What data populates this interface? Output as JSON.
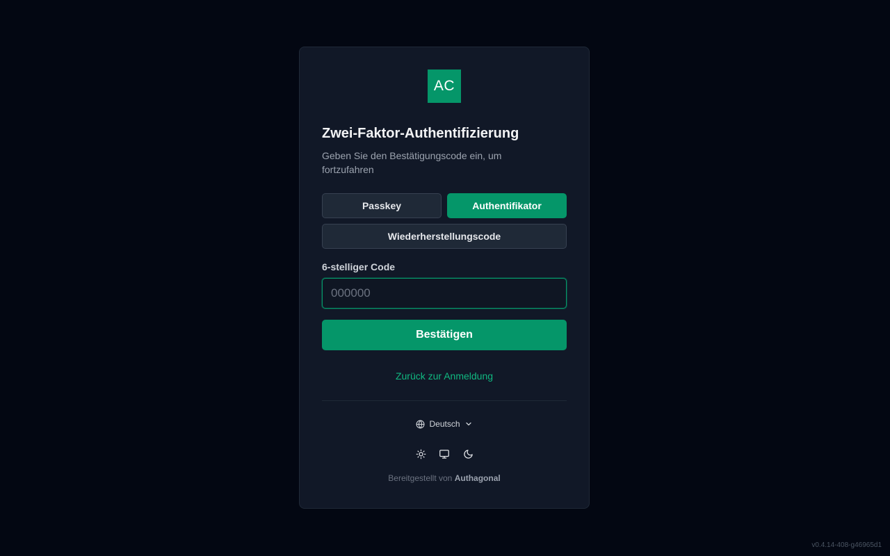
{
  "logo": {
    "text": "AC",
    "color": "#059669"
  },
  "title": "Zwei-Faktor-Authentifizierung",
  "subtitle": "Geben Sie den Bestätigungscode ein, um fortzufahren",
  "methods": {
    "passkey": "Passkey",
    "authenticator": "Authentifikator",
    "recovery": "Wiederherstellungscode",
    "active": "authenticator"
  },
  "code_field": {
    "label": "6-stelliger Code",
    "placeholder": "000000",
    "value": ""
  },
  "submit_label": "Bestätigen",
  "back_link": "Zurück zur Anmeldung",
  "language": {
    "selected": "Deutsch",
    "icon": "globe-icon"
  },
  "theme_icons": [
    "sun-icon",
    "monitor-icon",
    "moon-icon"
  ],
  "footer": {
    "powered_prefix": "Bereitgestellt von",
    "powered_brand": "Authagonal"
  },
  "version": "v0.4.14-408-g46965d1",
  "colors": {
    "accent": "#059669",
    "link": "#10b981",
    "background": "#030712",
    "card": "#111827"
  }
}
